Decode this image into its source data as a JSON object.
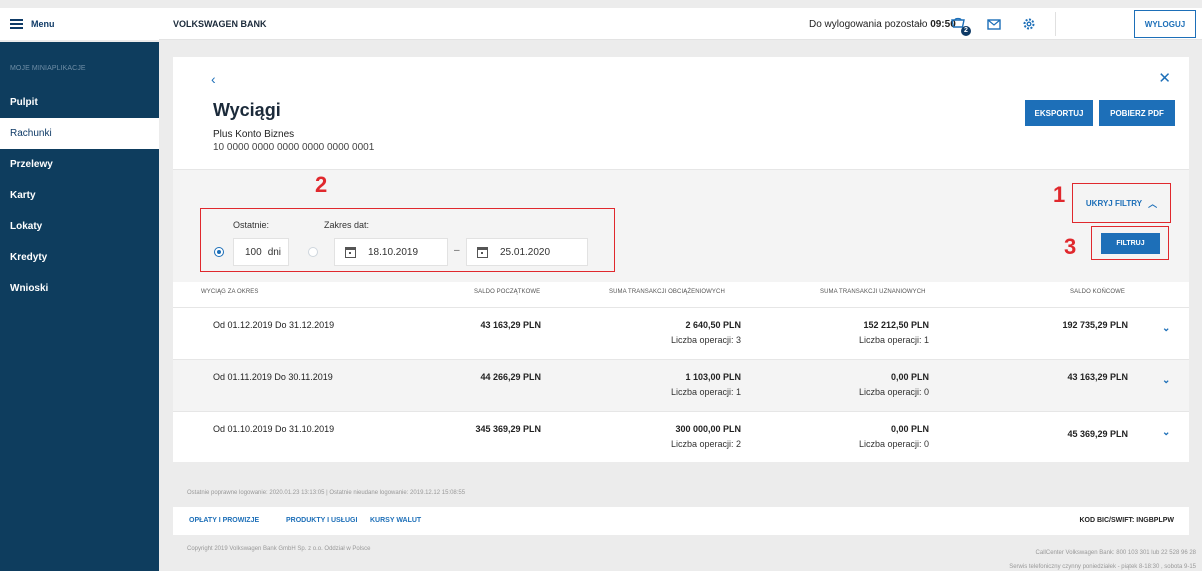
{
  "menu": {
    "label": "Menu"
  },
  "sidebar": {
    "caption": "MOJE MINIAPLIKACJE",
    "items": [
      {
        "label": "Pulpit"
      },
      {
        "label": "Rachunki"
      },
      {
        "label": "Przelewy"
      },
      {
        "label": "Karty"
      },
      {
        "label": "Lokaty"
      },
      {
        "label": "Kredyty"
      },
      {
        "label": "Wnioski"
      }
    ]
  },
  "header": {
    "brand": "VOLKSWAGEN BANK",
    "session_prefix": "Do wylogowania pozostało ",
    "session_time": "09:50",
    "cart_badge": "2",
    "logout": "WYLOGUJ"
  },
  "page": {
    "back_icon": "‹",
    "close_icon": "✕",
    "title": "Wyciągi",
    "account_name": "Plus Konto Biznes",
    "account_number": "10 0000 0000 0000 0000 0000 0001",
    "export": "EKSPORTUJ",
    "pdf": "POBIERZ PDF"
  },
  "filters": {
    "hide": "UKRYJ FILTRY",
    "last_label": "Ostatnie:",
    "range_label": "Zakres dat:",
    "days_value": "100",
    "days_unit": "dni",
    "date_from": "18.10.2019",
    "date_to": "25.01.2020",
    "dash": "–",
    "filter_button": "FILTRUJ"
  },
  "annotations": {
    "a1": "1",
    "a2": "2",
    "a3": "3"
  },
  "table": {
    "headers": [
      "WYCIĄG ZA OKRES",
      "SALDO POCZĄTKOWE",
      "SUMA TRANSAKCJI OBCIĄŻENIOWYCH",
      "SUMA TRANSAKCJI UZNANIOWYCH",
      "SALDO KOŃCOWE"
    ],
    "rows": [
      {
        "period": "Od 01.12.2019 Do 31.12.2019",
        "opening": "43 163,29 PLN",
        "debit": "2 640,50 PLN",
        "debit_ops": "Liczba operacji: 3",
        "credit": "152 212,50 PLN",
        "credit_ops": "Liczba operacji: 1",
        "closing": "192 735,29 PLN"
      },
      {
        "period": "Od 01.11.2019 Do 30.11.2019",
        "opening": "44 266,29 PLN",
        "debit": "1 103,00 PLN",
        "debit_ops": "Liczba operacji: 1",
        "credit": "0,00 PLN",
        "credit_ops": "Liczba operacji: 0",
        "closing": "43 163,29 PLN"
      },
      {
        "period": "Od 01.10.2019 Do 31.10.2019",
        "opening": "345 369,29 PLN",
        "debit": "300 000,00 PLN",
        "debit_ops": "Liczba operacji: 2",
        "credit": "0,00 PLN",
        "credit_ops": "Liczba operacji: 0",
        "closing": "45 369,29 PLN"
      }
    ]
  },
  "footer": {
    "login_info": "Ostatnie poprawne logowanie: 2020.01.23 13:13:05   |   Ostatnie nieudane logowanie: 2019.12.12 15:08:55",
    "links": [
      "OPŁATY I PROWIZJE",
      "PRODUKTY I USŁUGI",
      "KURSY WALUT"
    ],
    "swift": "KOD BIC/SWIFT: INGBPLPW",
    "copyright": "Copyright 2019 Volkswagen Bank GmbH Sp. z o.o. Oddział w Polsce",
    "callcenter": "CallCenter Volkswagen Bank: 800 103 301 lub 22 528 96 28",
    "hours": "Serwis telefoniczny czynny poniedziałek - piątek 8-18:30 , sobota 9-15"
  },
  "colors": {
    "accent": "#1d6fb8",
    "sidebar": "#0e3d5e",
    "annotation": "#e0282d"
  },
  "icons": [
    "hamburger-icon",
    "cart-icon",
    "mail-icon",
    "gear-icon",
    "chevron-left-icon",
    "close-icon",
    "chevron-up-icon",
    "calendar-icon",
    "chevron-down-icon"
  ]
}
